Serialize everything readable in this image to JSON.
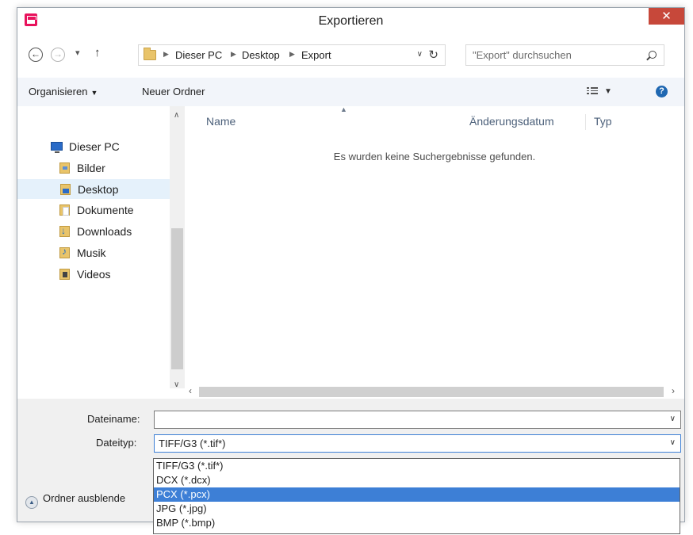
{
  "window": {
    "title": "Exportieren",
    "close": "✕"
  },
  "address": {
    "back": "←",
    "forward": "→",
    "recent": "▾",
    "up": "↑",
    "breadcrumbs": [
      "Dieser PC",
      "Desktop",
      "Export"
    ],
    "dropdown": "∨",
    "refresh": "↻",
    "search_placeholder": "\"Export\" durchsuchen"
  },
  "toolbar": {
    "organize": "Organisieren",
    "new_folder": "Neuer Ordner",
    "help": "?"
  },
  "sidebar": {
    "items": [
      {
        "label": "Dieser PC",
        "icon": "computer-icon"
      },
      {
        "label": "Bilder",
        "icon": "pictures-folder-icon"
      },
      {
        "label": "Desktop",
        "icon": "desktop-folder-icon",
        "selected": true
      },
      {
        "label": "Dokumente",
        "icon": "documents-folder-icon"
      },
      {
        "label": "Downloads",
        "icon": "downloads-folder-icon"
      },
      {
        "label": "Musik",
        "icon": "music-folder-icon"
      },
      {
        "label": "Videos",
        "icon": "videos-folder-icon"
      }
    ]
  },
  "content": {
    "columns": [
      "Name",
      "Änderungsdatum",
      "Typ"
    ],
    "empty_message": "Es wurden keine Suchergebnisse gefunden."
  },
  "form": {
    "filename_label": "Dateiname:",
    "filename_value": "",
    "filetype_label": "Dateityp:",
    "filetype_value": "TIFF/G3 (*.tif*)",
    "filetype_options": [
      "TIFF/G3 (*.tif*)",
      "DCX (*.dcx)",
      "PCX (*.pcx)",
      "JPG (*.jpg)",
      "BMP (*.bmp)"
    ],
    "highlighted_option": "PCX (*.pcx)",
    "hide_folders": "Ordner ausblende"
  },
  "colors": {
    "close_button": "#c7483a",
    "app_icon": "#e8125c",
    "selection": "#3d7fd6",
    "sidebar_selected": "#e5f1fb"
  }
}
